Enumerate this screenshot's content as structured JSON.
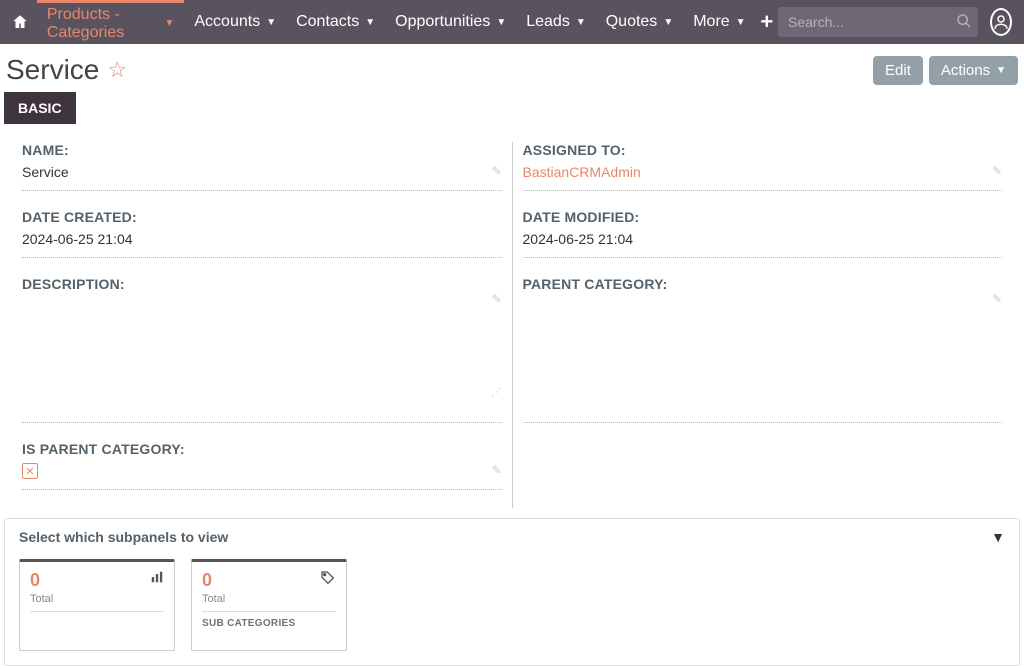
{
  "nav": {
    "active": "Products - Categories",
    "items": [
      "Products - Categories",
      "Accounts",
      "Contacts",
      "Opportunities",
      "Leads",
      "Quotes",
      "More"
    ]
  },
  "search": {
    "placeholder": "Search..."
  },
  "title": "Service",
  "buttons": {
    "edit": "Edit",
    "actions": "Actions"
  },
  "tab": "BASIC",
  "fields": {
    "name_label": "NAME:",
    "name_value": "Service",
    "assigned_label": "ASSIGNED TO:",
    "assigned_value": "BastianCRMAdmin",
    "created_label": "DATE CREATED:",
    "created_value": "2024-06-25 21:04",
    "modified_label": "DATE MODIFIED:",
    "modified_value": "2024-06-25 21:04",
    "desc_label": "DESCRIPTION:",
    "parent_cat_label": "PARENT CATEGORY:",
    "is_parent_label": "IS PARENT CATEGORY:"
  },
  "subpanels": {
    "header": "Select which subpanels to view",
    "cards": [
      {
        "count": "0",
        "total": "Total",
        "name": ""
      },
      {
        "count": "0",
        "total": "Total",
        "name": "SUB CATEGORIES"
      }
    ]
  }
}
